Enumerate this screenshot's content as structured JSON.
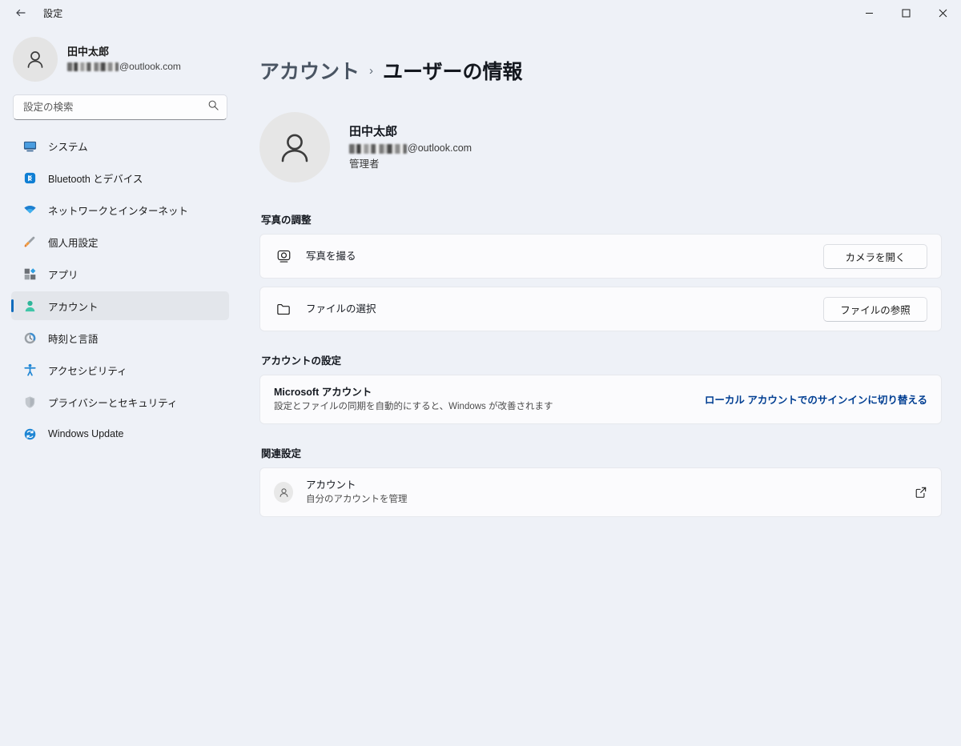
{
  "titlebar": {
    "back_label": "戻る",
    "title": "設定",
    "minimize_label": "最小化",
    "maximize_label": "最大化",
    "close_label": "閉じる"
  },
  "sidebar": {
    "profile": {
      "name": "田中太郎",
      "email_domain": "@outlook.com",
      "email_redacted": true
    },
    "search": {
      "placeholder": "設定の検索",
      "value": "",
      "icon": "search-icon"
    },
    "items": [
      {
        "label": "システム",
        "icon": "monitor-icon",
        "selected": false
      },
      {
        "label": "Bluetooth とデバイス",
        "icon": "bluetooth-icon",
        "selected": false
      },
      {
        "label": "ネットワークとインターネット",
        "icon": "wifi-icon",
        "selected": false
      },
      {
        "label": "個人用設定",
        "icon": "paintbrush-icon",
        "selected": false
      },
      {
        "label": "アプリ",
        "icon": "apps-icon",
        "selected": false
      },
      {
        "label": "アカウント",
        "icon": "account-person-icon",
        "selected": true
      },
      {
        "label": "時刻と言語",
        "icon": "clock-icon",
        "selected": false
      },
      {
        "label": "アクセシビリティ",
        "icon": "accessibility-icon",
        "selected": false
      },
      {
        "label": "プライバシーとセキュリティ",
        "icon": "shield-icon",
        "selected": false
      },
      {
        "label": "Windows Update",
        "icon": "update-icon",
        "selected": false
      }
    ]
  },
  "main": {
    "breadcrumb": {
      "parent": "アカウント",
      "separator": "›",
      "current": "ユーザーの情報"
    },
    "hero": {
      "name": "田中太郎",
      "email_domain": "@outlook.com",
      "role": "管理者",
      "avatar_icon": "person-avatar-icon"
    },
    "sections": [
      {
        "title": "写真の調整",
        "rows": [
          {
            "icon": "camera-icon",
            "title": "写真を撮る",
            "subtitle": "",
            "action_type": "button",
            "action_label": "カメラを開く"
          },
          {
            "icon": "folder-icon",
            "title": "ファイルの選択",
            "subtitle": "",
            "action_type": "button",
            "action_label": "ファイルの参照"
          }
        ]
      },
      {
        "title": "アカウントの設定",
        "rows": [
          {
            "icon": "",
            "title": "Microsoft アカウント",
            "subtitle": "設定とファイルの同期を自動的にすると、Windows が改善されます",
            "action_type": "link",
            "action_label": "ローカル アカウントでのサインインに切り替える"
          }
        ]
      },
      {
        "title": "関連設定",
        "rows": [
          {
            "icon": "mini-account-icon",
            "title": "アカウント",
            "subtitle": "自分のアカウントを管理",
            "action_type": "external",
            "action_label": "external-link-icon"
          }
        ]
      }
    ]
  },
  "colors": {
    "page_background": "#eef1f7",
    "card_background": "#fbfbfd",
    "accent_blue": "#0f6cbd",
    "link_blue": "#003e92",
    "selected_nav": "#e3e6eb"
  }
}
